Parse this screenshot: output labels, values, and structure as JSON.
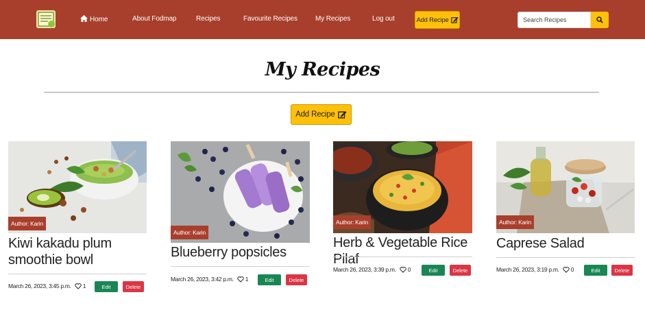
{
  "nav": {
    "logo_icon": "recipe-book-logo",
    "home": "Home",
    "about": "About Fodmap",
    "recipes": "Recipes",
    "favourites": "Favourite Recipes",
    "my_recipes": "My Recipes",
    "logout": "Log out",
    "add_recipe": "Add Recipe",
    "add_icon": "edit-icon",
    "search_placeholder": "Search Recipes",
    "search_icon": "search-icon"
  },
  "page": {
    "title": "My Recipes",
    "add_recipe": "Add Recipe"
  },
  "colors": {
    "brand": "#a83f2c",
    "accent": "#ffc107",
    "edit": "#198754",
    "delete": "#dc3545"
  },
  "recipes": [
    {
      "author": "Author: Karin",
      "title": "Kiwi kakadu plum smoothie bowl",
      "date": "March 26, 2023, 3:45 p.m.",
      "likes": "1",
      "edit": "Edit",
      "delete": "Delete"
    },
    {
      "author": "Author: Karin",
      "title": "Blueberry popsicles",
      "date": "March 26, 2023, 3:42 p.m.",
      "likes": "1",
      "edit": "Edit",
      "delete": "Delete"
    },
    {
      "author": "Author: Karin",
      "title": "Herb & Vegetable Rice Pilaf",
      "date": "March 26, 2023, 3:39 p.m.",
      "likes": "0",
      "edit": "Edit",
      "delete": "Delete"
    },
    {
      "author": "Author: Karin",
      "title": "Caprese Salad",
      "date": "March 26, 2023, 3:19 p.m.",
      "likes": "0",
      "edit": "Edit",
      "delete": "Delete"
    }
  ]
}
